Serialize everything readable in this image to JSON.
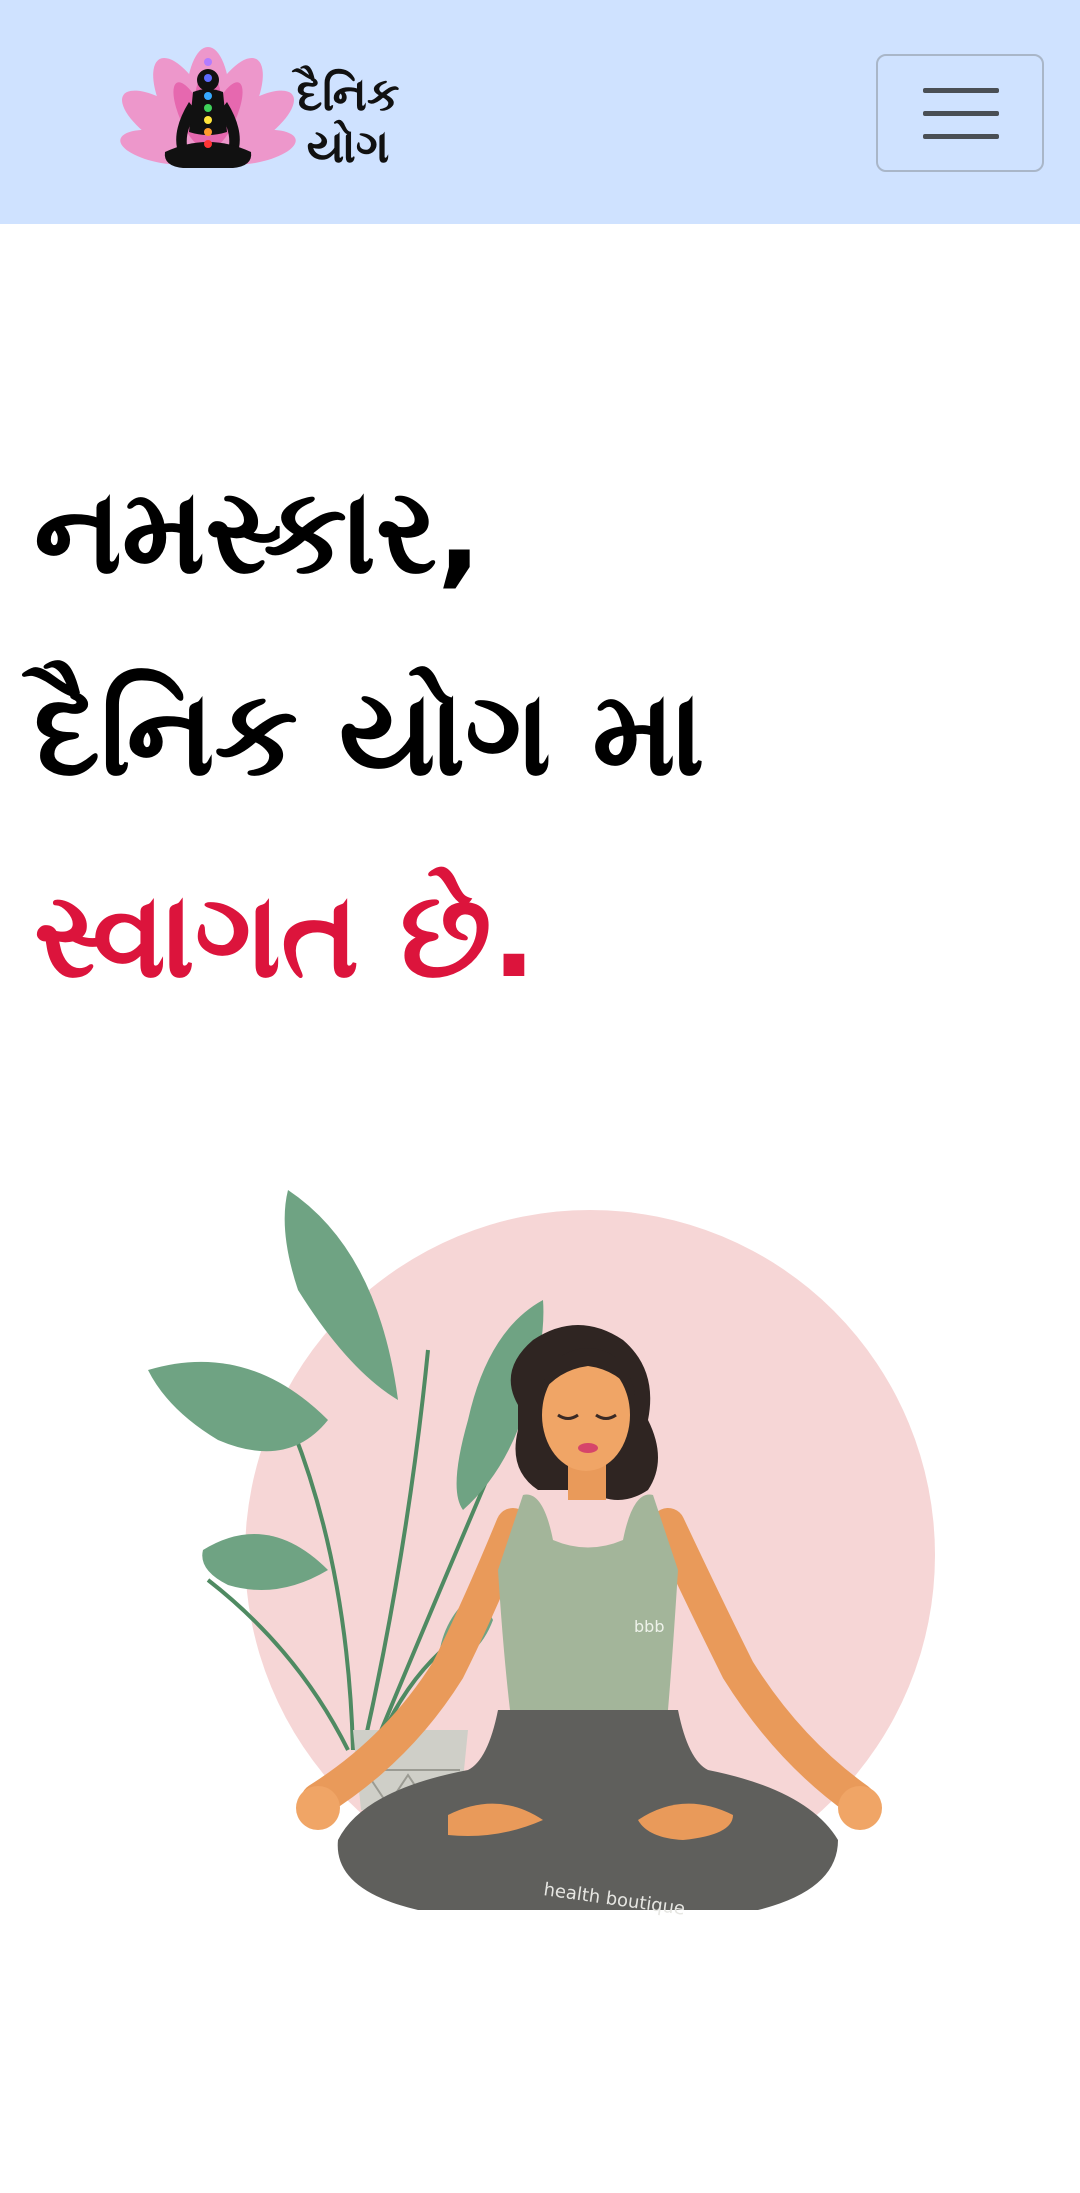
{
  "navbar": {
    "brand_line1": "દૈનિક",
    "brand_line2": "યોગ",
    "brand_logo_icon": "meditation-lotus-chakra-icon",
    "menu_icon": "hamburger-menu-icon",
    "background": "#cfe2ff"
  },
  "hero": {
    "line1": "નમસ્કાર,",
    "line2": "દૈનિક યોગ મા",
    "line3": "સ્વાગત છે.",
    "accent_color": "#dc143c"
  },
  "illustration": {
    "shirt_text": "bbb",
    "pants_text": "health boutique",
    "icon": "yoga-meditation-illustration"
  }
}
